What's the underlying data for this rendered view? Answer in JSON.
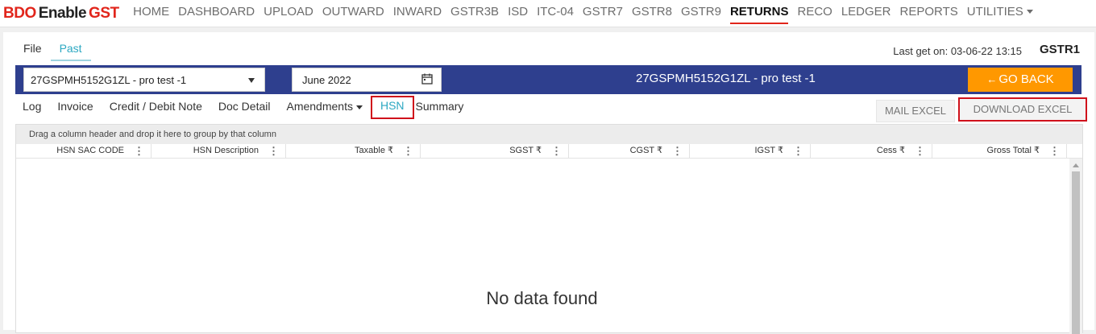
{
  "logo": {
    "bdo": "BDO",
    "enable": "Enable",
    "gst": "GST"
  },
  "nav": {
    "items": [
      {
        "label": "HOME"
      },
      {
        "label": "DASHBOARD"
      },
      {
        "label": "UPLOAD"
      },
      {
        "label": "OUTWARD"
      },
      {
        "label": "INWARD"
      },
      {
        "label": "GSTR3B"
      },
      {
        "label": "ISD"
      },
      {
        "label": "ITC-04"
      },
      {
        "label": "GSTR7"
      },
      {
        "label": "GSTR8"
      },
      {
        "label": "GSTR9"
      },
      {
        "label": "RETURNS",
        "active": true
      },
      {
        "label": "RECO"
      },
      {
        "label": "LEDGER"
      },
      {
        "label": "REPORTS"
      },
      {
        "label": "UTILITIES",
        "has_dropdown": true
      }
    ]
  },
  "subtabs": [
    {
      "label": "File"
    },
    {
      "label": "Past",
      "active": true
    }
  ],
  "last_get": "Last get on: 03-06-22 13:15",
  "return_type": "GSTR1",
  "toolbar": {
    "gstin_select": "27GSPMH5152G1ZL - pro test -1",
    "period": "June 2022",
    "title": "27GSPMH5152G1ZL - pro test -1",
    "go_back": "GO BACK",
    "accent": "#ff9800",
    "bar_color": "#2e3f8e"
  },
  "grid_tabs": [
    {
      "label": "Log"
    },
    {
      "label": "Invoice"
    },
    {
      "label": "Credit / Debit Note"
    },
    {
      "label": "Doc Detail"
    },
    {
      "label": "Amendments",
      "has_dropdown": true
    },
    {
      "label": "HSN",
      "active": true
    },
    {
      "label": "Summary"
    }
  ],
  "actions": {
    "mail_excel": "MAIL EXCEL",
    "download_excel": "DOWNLOAD EXCEL"
  },
  "grid": {
    "group_hint": "Drag a column header and drop it here to group by that column",
    "columns": [
      "HSN SAC CODE",
      "HSN Description",
      "Taxable ₹",
      "SGST ₹",
      "CGST ₹",
      "IGST ₹",
      "Cess ₹",
      "Gross Total ₹"
    ],
    "empty_message": "No data found"
  }
}
